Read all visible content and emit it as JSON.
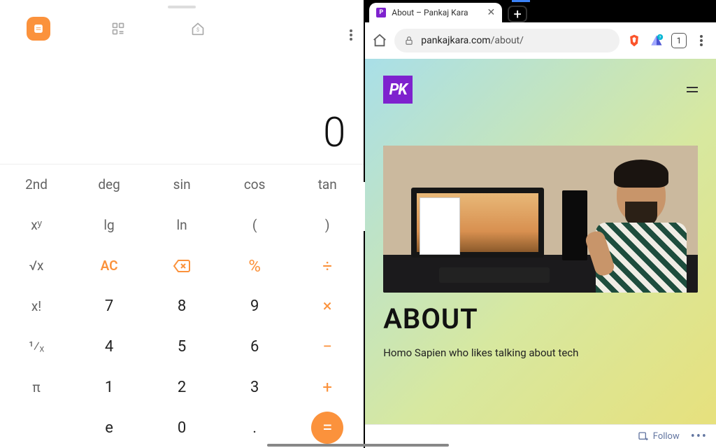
{
  "calculator": {
    "display": "0",
    "tabs": [
      "standard",
      "converter",
      "currency"
    ],
    "rows": [
      [
        "2nd",
        "deg",
        "sin",
        "cos",
        "tan"
      ],
      [
        "xʸ",
        "lg",
        "ln",
        "(",
        ")"
      ],
      [
        "√x",
        "AC",
        "⌫",
        "%",
        "÷"
      ],
      [
        "x!",
        "7",
        "8",
        "9",
        "×"
      ],
      [
        "¹⁄ₓ",
        "4",
        "5",
        "6",
        "−"
      ],
      [
        "π",
        "1",
        "2",
        "3",
        "+"
      ],
      [
        "",
        "e",
        "0",
        ".",
        "="
      ]
    ]
  },
  "browser": {
    "tab_title": "About – Pankaj Kara",
    "url_host": "pankajkara.com",
    "url_path": "/about/",
    "open_tab_count": "1",
    "page": {
      "logo_text": "PK",
      "heading": "ABOUT",
      "tagline": "Homo Sapien who likes talking about tech",
      "follow_label": "Follow"
    }
  }
}
